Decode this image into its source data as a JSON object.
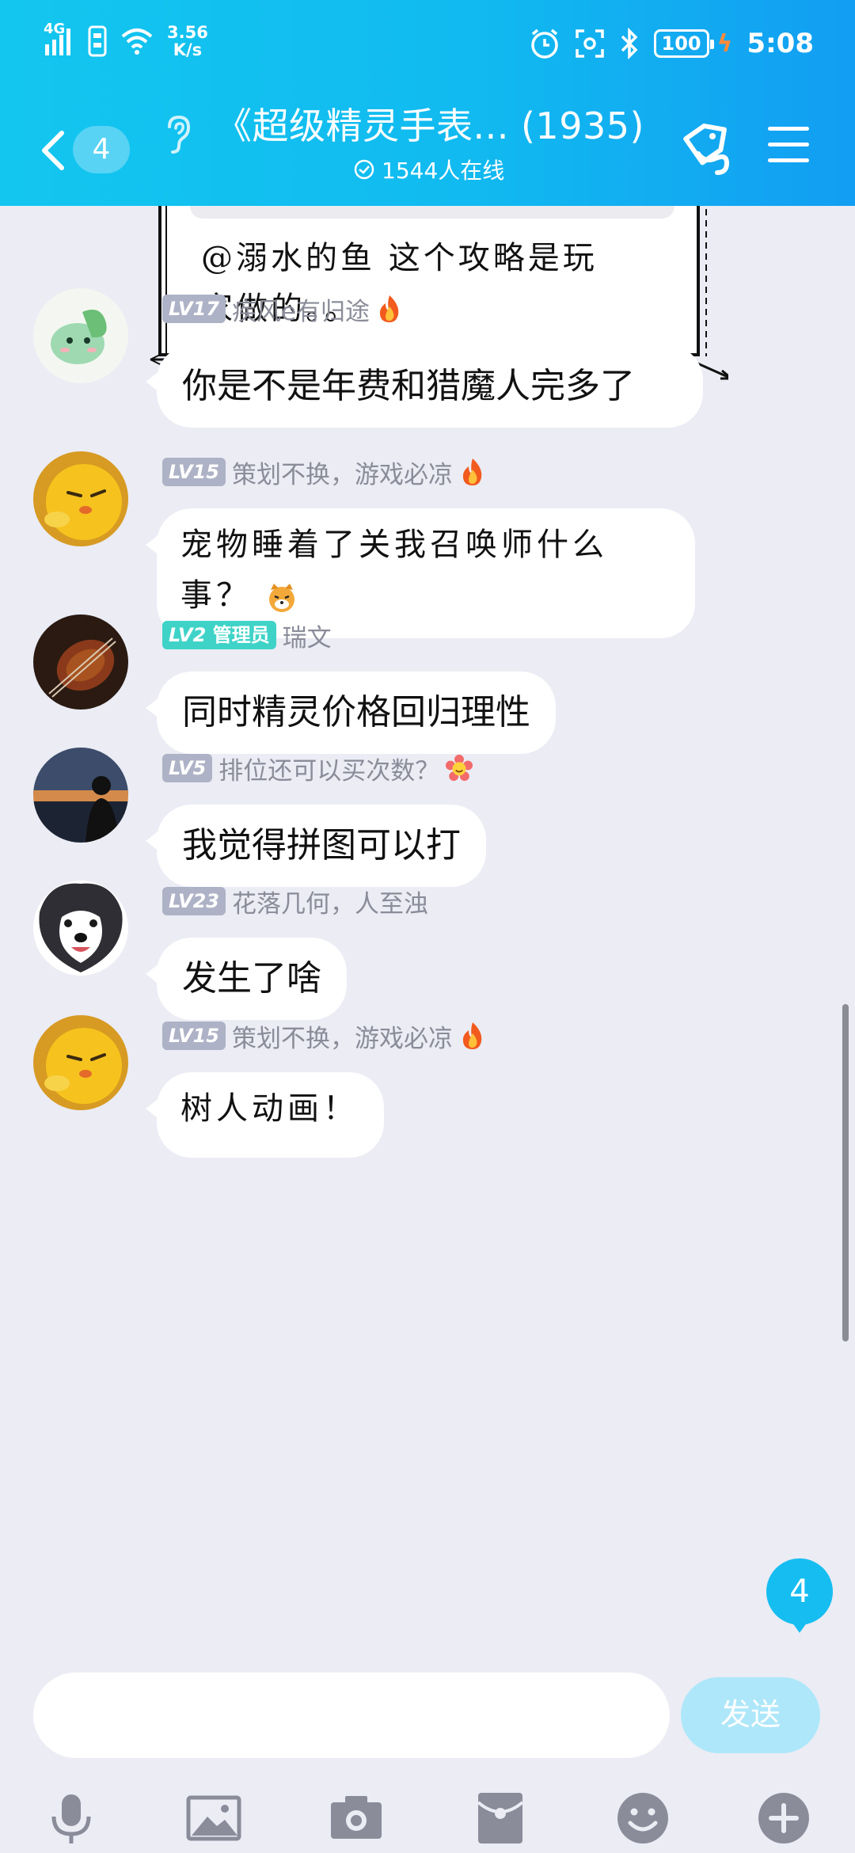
{
  "status_bar": {
    "network": "4G",
    "speed_value": "3.56",
    "speed_unit": "K/s",
    "battery": "100",
    "time": "5:08"
  },
  "header": {
    "back_count": "4",
    "title": "《超级精灵手表... (1935)",
    "online": "1544人在线"
  },
  "top_message": {
    "text_line1": "@溺水的鱼 这个攻略是玩",
    "text_line2": "家做的。。"
  },
  "messages": [
    {
      "level": "LV17",
      "name": "疾风e有归途",
      "badge_icon": "fire-icon",
      "text": "你是不是年费和猎魔人完多了"
    },
    {
      "level": "LV15",
      "name": "策划不换，游戏必凉",
      "badge_icon": "fire-icon",
      "text": "宠物睡着了关我召唤师什么事？"
    },
    {
      "level": "LV2",
      "role": "管理员",
      "name": "瑞文",
      "text": "同时精灵价格回归理性"
    },
    {
      "level": "LV5",
      "name": "排位还可以买次数？",
      "badge_icon": "flower-icon",
      "text": "我觉得拼图可以打"
    },
    {
      "level": "LV23",
      "name": "花落几何，人至浊",
      "text": "发生了啥"
    },
    {
      "level": "LV15",
      "name": "策划不换，游戏必凉",
      "badge_icon": "fire-icon",
      "text": "树人动画！"
    }
  ],
  "unread_badge": "4",
  "input": {
    "placeholder": "",
    "send_label": "发送"
  },
  "toolbar_icons": [
    "microphone-icon",
    "image-icon",
    "camera-icon",
    "red-packet-icon",
    "emoji-icon",
    "plus-icon"
  ],
  "colors": {
    "header_start": "#13c6ef",
    "header_end": "#129ef2",
    "background": "#ebecf4",
    "admin_badge": "#3fd3c8",
    "level_badge": "#aeb2c6",
    "send_button": "#aee7fa"
  }
}
